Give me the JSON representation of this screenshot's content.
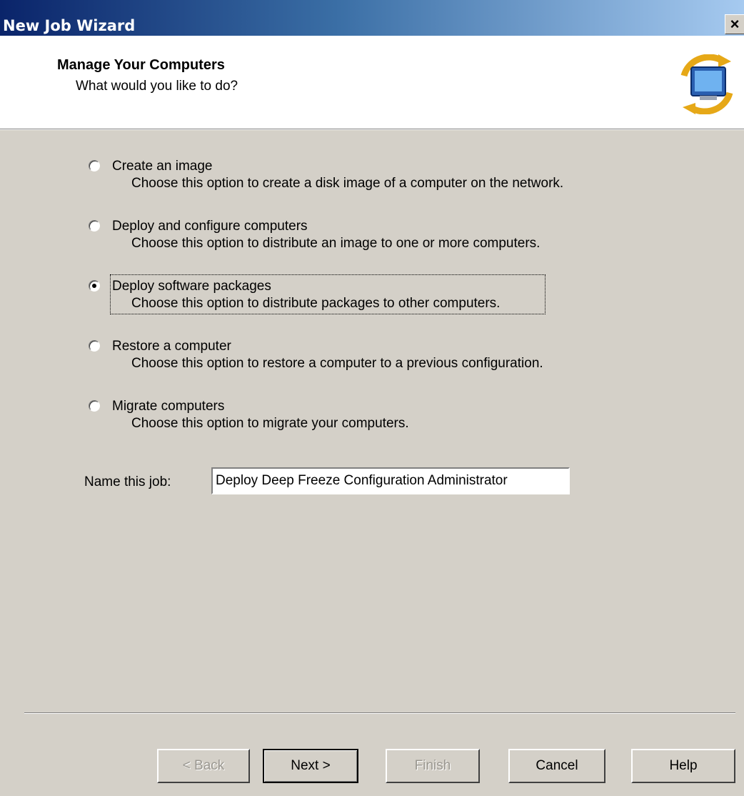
{
  "window": {
    "title": "New Job Wizard",
    "close_glyph": "×"
  },
  "header": {
    "title": "Manage Your Computers",
    "subtitle": "What would you like to do?",
    "icon": "computer-sync-icon"
  },
  "options": [
    {
      "label": "Create an image",
      "description": "Choose this option to create a disk image of a computer on the network.",
      "selected": false
    },
    {
      "label": "Deploy and configure computers",
      "description": "Choose this option to distribute an image to one or more computers.",
      "selected": false
    },
    {
      "label": "Deploy software packages",
      "description": "Choose this option to distribute packages to other computers.",
      "selected": true
    },
    {
      "label": "Restore a computer",
      "description": "Choose this option to restore a computer to a previous configuration.",
      "selected": false
    },
    {
      "label": "Migrate computers",
      "description": "Choose this option to migrate your computers.",
      "selected": false
    }
  ],
  "job_name": {
    "label": "Name this job:",
    "value": "Deploy Deep Freeze Configuration Administrator"
  },
  "buttons": {
    "back": "< Back",
    "next": "Next >",
    "finish": "Finish",
    "cancel": "Cancel",
    "help": "Help"
  },
  "colors": {
    "titlebar_start": "#0a246a",
    "titlebar_end": "#a6caf0",
    "dialog_bg": "#d4d0c8"
  }
}
